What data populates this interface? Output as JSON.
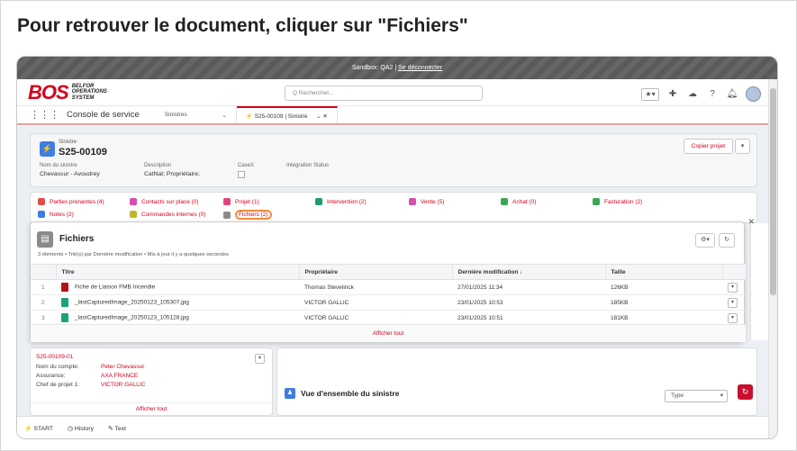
{
  "slide_title": "Pour retrouver le document, cliquer sur \"Fichiers\"",
  "sandbox": {
    "text": "Sandbox: QA2 |",
    "logout": "Se déconnecter"
  },
  "logo": {
    "mark": "BOS",
    "line1": "BELFOR",
    "line2": "OPERATIONS",
    "line3": "SYSTEM"
  },
  "search": {
    "placeholder": "Q  Rechercher..."
  },
  "nav": {
    "app_title": "Console de service",
    "tab1": "Sinistres",
    "tab2": "S25-00109 | Sinistre",
    "tab2_icon": "⚡"
  },
  "record": {
    "type": "Sinistre",
    "name": "S25-00109",
    "copy_button": "Copier projet",
    "fields": [
      {
        "label": "Nom du sinistre",
        "value": "Chevassur - Avoudrey"
      },
      {
        "label": "Description",
        "value": "CatNat; Propriétaire;"
      },
      {
        "label": "CaseX",
        "value": ""
      },
      {
        "label": "Integration Status",
        "value": ""
      }
    ]
  },
  "related": {
    "row1": [
      {
        "label": "Parties prenantes (4)",
        "color": "#e04e4e"
      },
      {
        "label": "Contacts sur place (0)",
        "color": "#d64fb0"
      },
      {
        "label": "Projet (1)",
        "color": "#e0457b"
      },
      {
        "label": "Intervention (2)",
        "color": "#1e9c6b"
      },
      {
        "label": "Vente (5)",
        "color": "#d64fb0"
      },
      {
        "label": "Achat (0)",
        "color": "#3ba755"
      },
      {
        "label": "Facturation (2)",
        "color": "#3ba755"
      }
    ],
    "row2": [
      {
        "label": "Notes (2)",
        "color": "#3e7ee0"
      },
      {
        "label": "Commandes internes (0)",
        "color": "#c4b42a"
      },
      {
        "label": "Fichiers (2)",
        "color": "#8a8a8a"
      }
    ]
  },
  "files_panel": {
    "title": "Fichiers",
    "subtitle": "3 éléments • Trié(s) par Dernière modification • Mis à jour il y a quelques secondes",
    "columns": [
      "Titre",
      "Propriétaire",
      "Dernière modification ↓",
      "Taille"
    ],
    "rows": [
      {
        "num": "1",
        "title": "Fiche de Liaison FMB Incendie",
        "owner": "Thomas Stevelinck",
        "modified": "27/01/2025 11:34",
        "size": "126KB",
        "icon_color": "#b5121b"
      },
      {
        "num": "2",
        "title": "_lastCapturedImage_20250123_105307.jpg",
        "owner": "VICTOR GALLIC",
        "modified": "23/01/2025 10:53",
        "size": "185KB",
        "icon_color": "#1aa37a"
      },
      {
        "num": "3",
        "title": "_lastCapturedImage_20250123_105128.jpg",
        "owner": "VICTOR GALLIC",
        "modified": "23/01/2025 10:51",
        "size": "181KB",
        "icon_color": "#1aa37a"
      }
    ],
    "show_all": "Afficher tout"
  },
  "left_card": {
    "id": "S25-00109-01",
    "rows": [
      {
        "label": "Nom du compte:",
        "value": "Peter Chevassur"
      },
      {
        "label": "Assurance:",
        "value": "AXA FRANCE"
      },
      {
        "label": "Chef de projet 1:",
        "value": "VICTOR GALLIC"
      }
    ],
    "show_all": "Afficher tout"
  },
  "overview": {
    "title": "Vue d'ensemble du sinistre",
    "type_placeholder": "Type"
  },
  "footer": {
    "start": "START",
    "history": "History",
    "text": "Text"
  }
}
